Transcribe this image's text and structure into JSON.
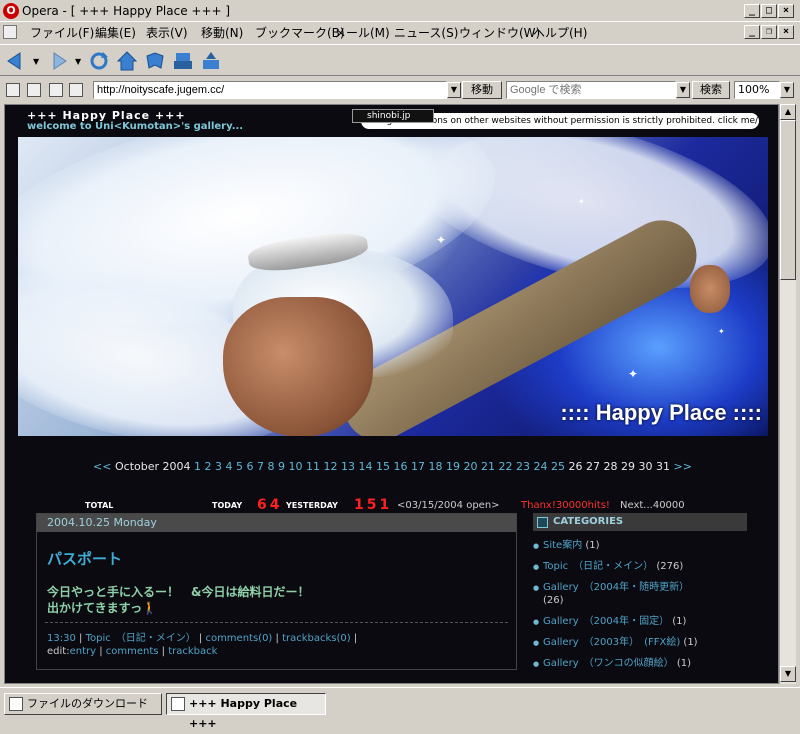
{
  "window": {
    "title": "Opera - [ +++ Happy Place +++ ]",
    "logo_letter": "O"
  },
  "menu": [
    "ファイル(F)",
    "編集(E)",
    "表示(V)",
    "移動(N)",
    "ブックマーク(B)",
    "メール(M)",
    "ニュース(S)",
    "ウィンドウ(W)",
    "ヘルプ(H)"
  ],
  "address": {
    "url": "http://noityscafe.jugem.cc/",
    "go_label": "移動",
    "search_placeholder": "Google で検索",
    "search_button": "検索",
    "zoom": "100%"
  },
  "page": {
    "site_title": "+++ Happy Place +++",
    "site_subtitle": "welcome to Uni<Kumotan>'s gallery...",
    "shinobi": "shinobi.jp",
    "warning": "Using illustrations on other websites without permission is strictly prohibited. click me/ OFP",
    "banner_text": ":::: Happy Place ::::",
    "calendar": {
      "prev": "<<",
      "month": "October 2004",
      "linked_days": [
        "1",
        "2",
        "3",
        "4",
        "5",
        "6",
        "7",
        "8",
        "9",
        "10",
        "11",
        "12",
        "13",
        "14",
        "15",
        "16",
        "17",
        "18",
        "19",
        "20",
        "21",
        "22",
        "23",
        "24",
        "25"
      ],
      "plain_days": [
        "26",
        "27",
        "28",
        "29",
        "30",
        "31"
      ],
      "next": ">>"
    },
    "counter": {
      "total_label": "TOTAL",
      "today_label": "TODAY",
      "today_value": "64",
      "yesterday_label": "YESTERDAY",
      "yesterday_value": "151",
      "open_text": "<03/15/2004 open>",
      "thanks_text": "Thanx!30000hits!",
      "next_text": "Next...40000"
    },
    "post": {
      "date": "2004.10.25 Monday",
      "title": "パスポート",
      "line1": "今日やっと手に入るー！　&今日は給料日だー！",
      "line2": "出かけてきますっ",
      "time": "13:30",
      "category": "Topic　（日記・メイン）",
      "comments": "comments(0)",
      "trackbacks": "trackbacks(0)",
      "edit_label": "edit:",
      "edit_entry": "entry",
      "edit_comments": "comments",
      "edit_trackback": "trackback"
    },
    "categories": {
      "title": "CATEGORIES",
      "items": [
        {
          "name": "Site案内",
          "count": "(1)"
        },
        {
          "name": "Topic　（日記・メイン）",
          "count": "(276)"
        },
        {
          "name": "Gallery　（2004年・随時更新）",
          "count": "(26)"
        },
        {
          "name": "Gallery　（2004年・固定）",
          "count": "(1)"
        },
        {
          "name": "Gallery　（2003年）　(FFX絵)",
          "count": "(1)"
        },
        {
          "name": "Gallery　（ワンコの似顔絵）",
          "count": "(1)"
        }
      ]
    }
  },
  "taskbar": {
    "downloads": "ファイルのダウンロード",
    "tab": "+++ Happy Place +++"
  },
  "colors": {
    "page_bg": "#0a0a10",
    "link": "#4fa3c8",
    "counter_red": "#ff2020"
  }
}
